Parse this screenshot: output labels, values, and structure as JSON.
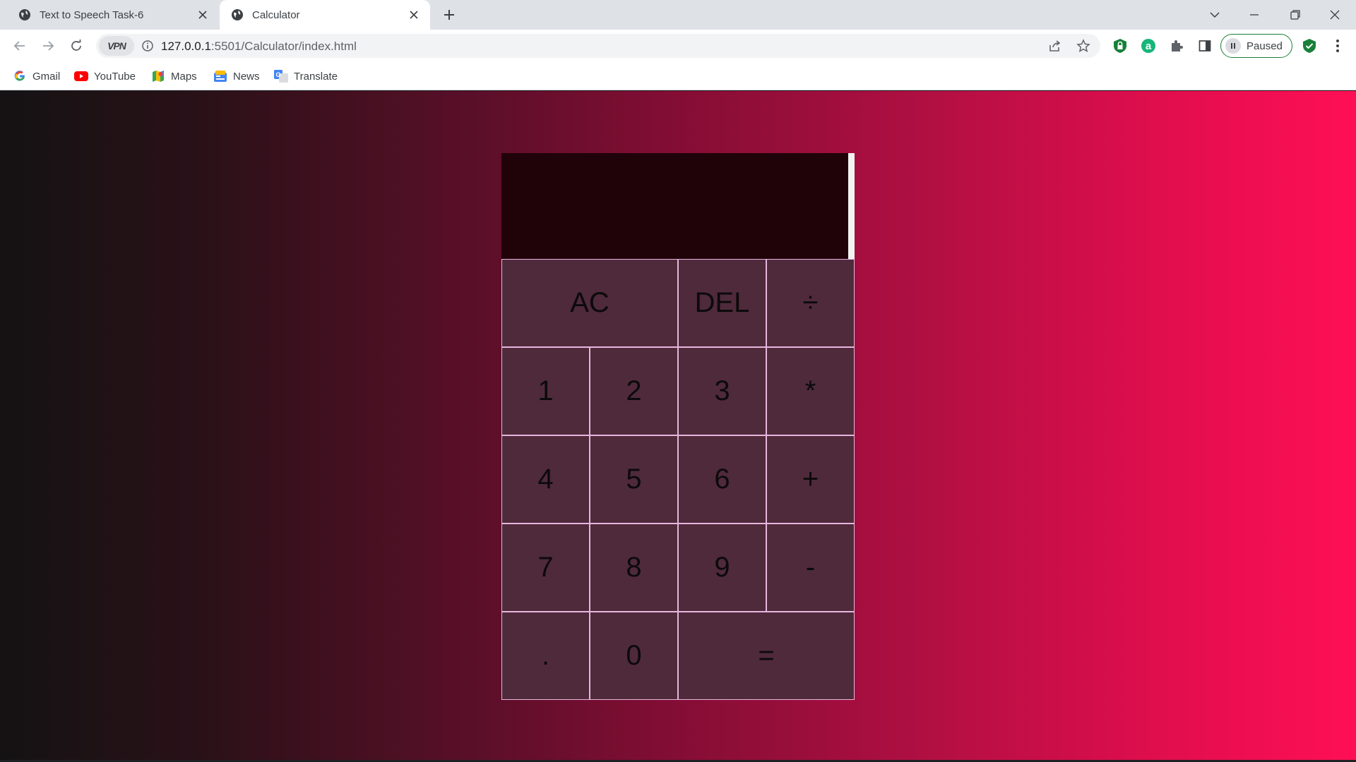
{
  "browser": {
    "tabs": [
      {
        "title": "Text to Speech Task-6",
        "active": false
      },
      {
        "title": "Calculator",
        "active": true
      }
    ],
    "address": {
      "host": "127.0.0.1",
      "path": ":5501/Calculator/index.html",
      "vpn_label": "VPN"
    },
    "profile_status": "Paused",
    "bookmarks": [
      {
        "label": "Gmail",
        "icon": "gmail-icon"
      },
      {
        "label": "YouTube",
        "icon": "youtube-icon"
      },
      {
        "label": "Maps",
        "icon": "maps-icon"
      },
      {
        "label": "News",
        "icon": "news-icon"
      },
      {
        "label": "Translate",
        "icon": "translate-icon"
      }
    ]
  },
  "calculator": {
    "display": {
      "previous": "",
      "current": ""
    },
    "keys": {
      "clear": "AC",
      "delete": "DEL",
      "divide": "÷",
      "one": "1",
      "two": "2",
      "three": "3",
      "multiply": "*",
      "four": "4",
      "five": "5",
      "six": "6",
      "add": "+",
      "seven": "7",
      "eight": "8",
      "nine": "9",
      "subtract": "-",
      "decimal": ".",
      "zero": "0",
      "equals": "="
    }
  },
  "colors": {
    "key_background": "#4f2a3b",
    "key_border": "#e7b6dd",
    "display_background": "#200309",
    "gradient_start": "#141213",
    "gradient_end": "#ff0f55"
  }
}
